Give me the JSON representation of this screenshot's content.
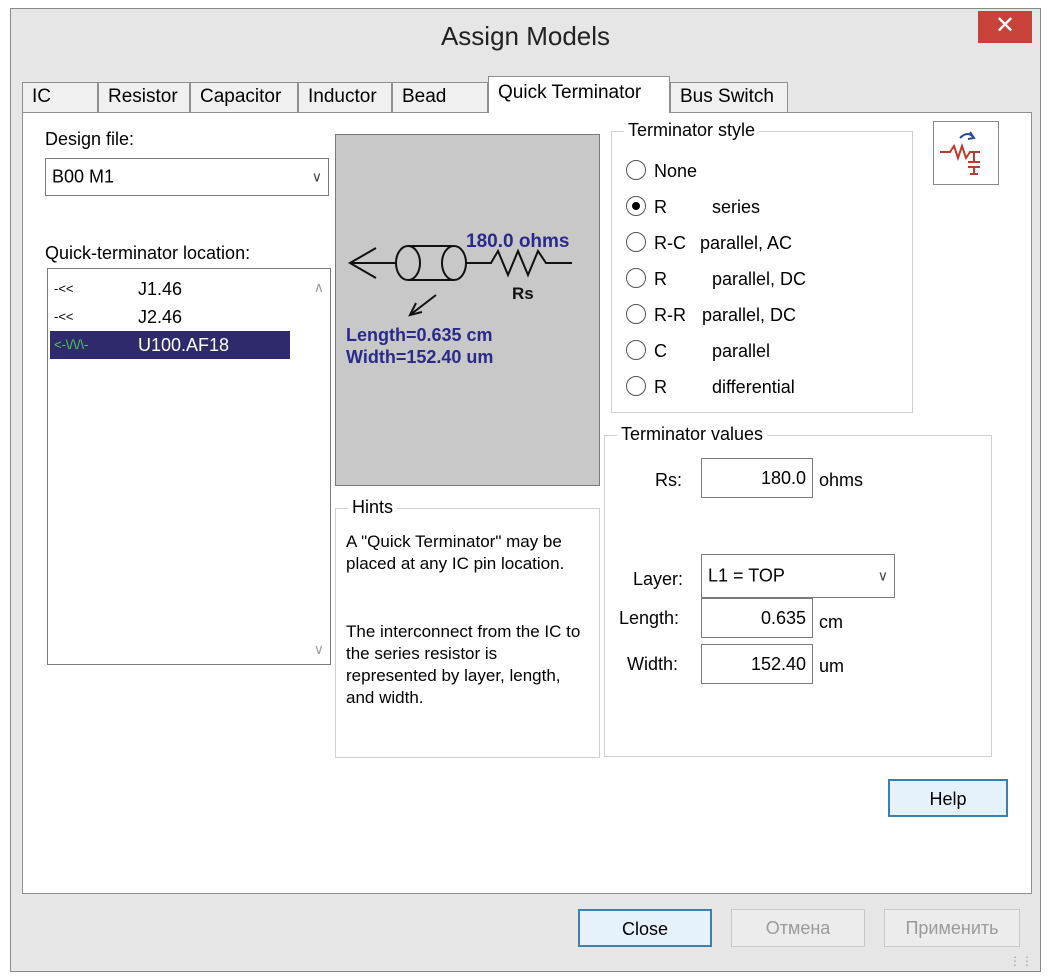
{
  "window": {
    "title": "Assign Models",
    "close_glyph": "✕"
  },
  "tabs": [
    {
      "label": "IC"
    },
    {
      "label": "Resistor"
    },
    {
      "label": "Capacitor"
    },
    {
      "label": "Inductor"
    },
    {
      "label": "Bead"
    },
    {
      "label": "Quick Terminator",
      "active": true
    },
    {
      "label": "Bus Switch"
    }
  ],
  "design_file": {
    "label": "Design file:",
    "value": "B00 M1"
  },
  "location": {
    "label": "Quick-terminator location:",
    "items": [
      {
        "icon": "-<<",
        "text": "J1.46"
      },
      {
        "icon": "-<<",
        "text": "J2.46"
      },
      {
        "icon": "<-\\/\\/\\-",
        "text": "U100.AF18",
        "selected": true
      }
    ]
  },
  "preview": {
    "ohms_text": "180.0 ohms",
    "rs_text": "Rs",
    "length_text": "Length=0.635 cm",
    "width_text": "Width=152.40 um"
  },
  "terminator_style": {
    "title": "Terminator style",
    "options": [
      {
        "a": "None",
        "b": ""
      },
      {
        "a": "R",
        "b": "series",
        "selected": true
      },
      {
        "a": "R-C",
        "b": "parallel, AC"
      },
      {
        "a": "R",
        "b": "parallel, DC"
      },
      {
        "a": "R-R",
        "b": "parallel, DC"
      },
      {
        "a": "C",
        "b": "parallel"
      },
      {
        "a": "R",
        "b": "differential"
      }
    ]
  },
  "hints": {
    "title": "Hints",
    "p1": "A \"Quick Terminator\" may be placed at any IC pin location.",
    "p2": "The interconnect from the IC to the series resistor is represented by layer, length, and width."
  },
  "values": {
    "title": "Terminator values",
    "rs_label": "Rs:",
    "rs_value": "180.0",
    "rs_unit": "ohms",
    "layer_label": "Layer:",
    "layer_value": "L1 = TOP",
    "length_label": "Length:",
    "length_value": "0.635",
    "length_unit": "cm",
    "width_label": "Width:",
    "width_value": "152.40",
    "width_unit": "um"
  },
  "buttons": {
    "help": "Help",
    "close": "Close",
    "cancel": "Отмена",
    "apply": "Применить"
  },
  "colors": {
    "selection": "#2e2a6b",
    "preview_text": "#2a2a8a",
    "close_red": "#c9423a"
  }
}
